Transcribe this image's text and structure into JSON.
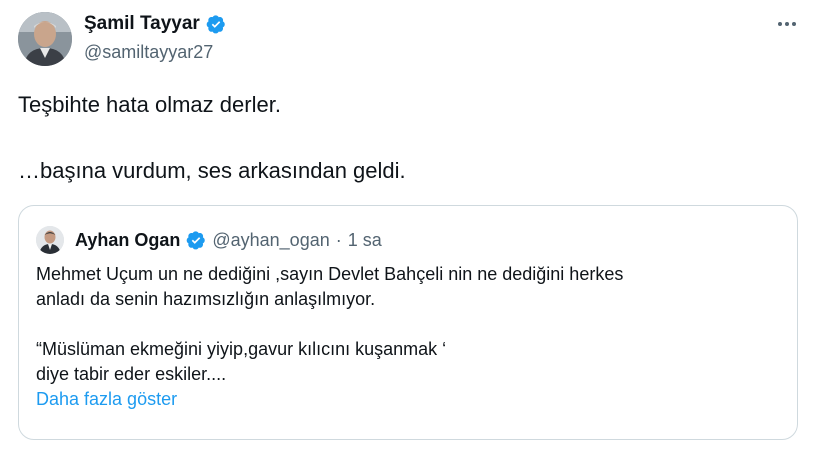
{
  "author": {
    "name": "Şamil Tayyar",
    "handle": "@samiltayyar27"
  },
  "tweet": {
    "line1": "Teşbihte hata olmaz derler.",
    "line2": "…başına vurdum, ses arkasından geldi."
  },
  "quoted": {
    "name": "Ayhan Ogan",
    "handle": "@ayhan_ogan",
    "separator": "·",
    "time": "1 sa",
    "line1": "Mehmet Uçum un ne dediğini ,sayın Devlet Bahçeli nin ne dediğini herkes",
    "line2": "anladı da senin hazımsızlığın anlaşılmıyor.",
    "line3": "“Müslüman ekmeğini yiyip,gavur kılıcını kuşanmak ‘",
    "line4": "diye tabir eder eskiler....",
    "show_more": "Daha fazla göster"
  },
  "colors": {
    "verified": "#1d9bf0",
    "link": "#1d9bf0",
    "secondary_text": "#536471",
    "border": "#cfd9de"
  },
  "icons": {
    "verified": "verified-badge-icon",
    "more": "more-options-icon"
  }
}
